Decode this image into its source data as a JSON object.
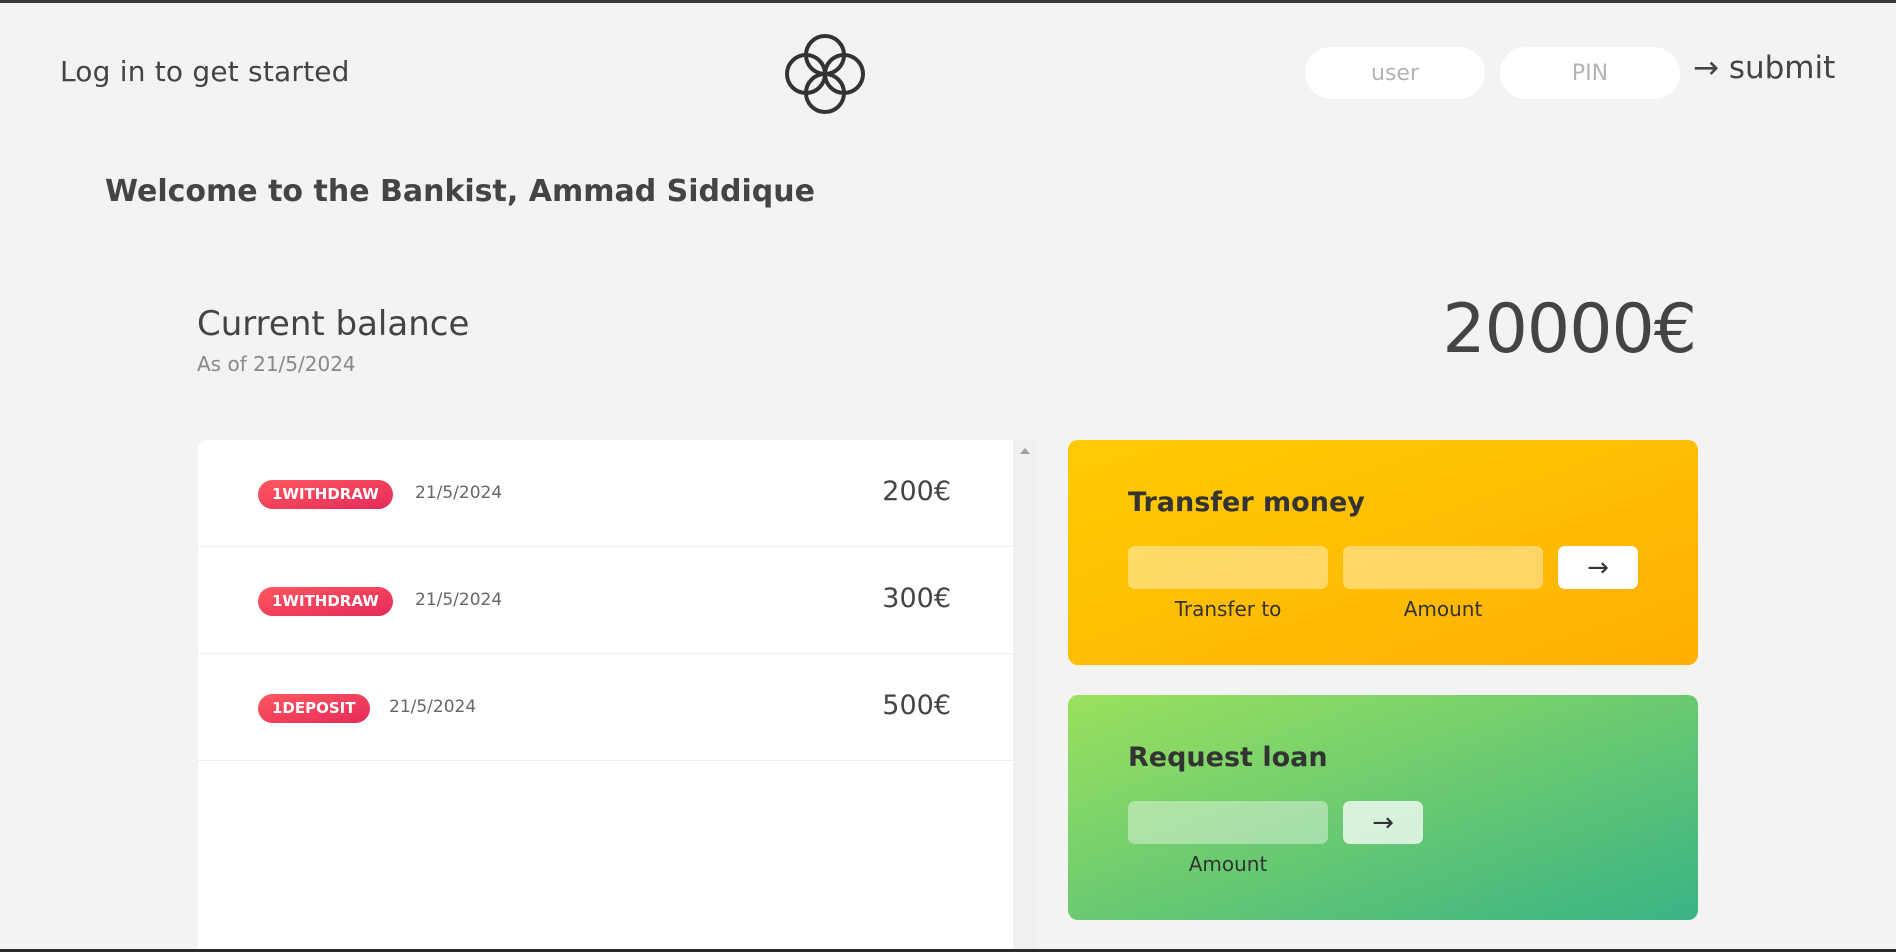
{
  "nav": {
    "welcome": "Log in to get started",
    "login": {
      "user_placeholder": "user",
      "pin_placeholder": "PIN",
      "submit_label": "→ submit"
    }
  },
  "welcome_message": "Welcome to the Bankist, Ammad Siddique",
  "balance": {
    "label": "Current balance",
    "date": "As of 21/5/2024",
    "value": "20000€"
  },
  "movements": [
    {
      "type": "1withdraw",
      "date": "21/5/2024",
      "value": "200€"
    },
    {
      "type": "1withdraw",
      "date": "21/5/2024",
      "value": "300€"
    },
    {
      "type": "1deposit",
      "date": "21/5/2024",
      "value": "500€"
    }
  ],
  "operations": {
    "transfer": {
      "title": "Transfer money",
      "to_label": "Transfer to",
      "amount_label": "Amount",
      "button": "→"
    },
    "loan": {
      "title": "Request loan",
      "amount_label": "Amount",
      "button": "→"
    }
  },
  "colors": {
    "background": "#f3f3f3",
    "withdrawal_badge": "#e52a5a",
    "transfer_gradient": [
      "#ffb003",
      "#ffcb03"
    ],
    "loan_gradient": [
      "#39b385",
      "#9be15d"
    ]
  }
}
